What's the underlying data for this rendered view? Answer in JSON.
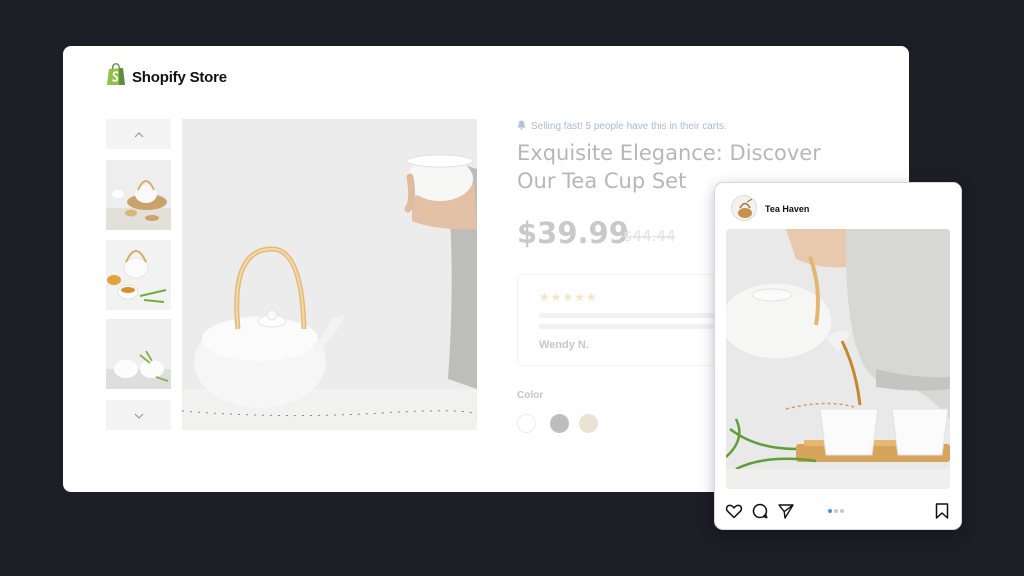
{
  "store": {
    "brand_name": "Shopify Store",
    "logo_icon": "shopping-bag-icon",
    "brand_color": "#95bf47"
  },
  "gallery": {
    "up_icon": "chevron-up-icon",
    "down_icon": "chevron-down-icon"
  },
  "product": {
    "urgency_text": "Selling fast! 5 people have this in their carts.",
    "urgency_icon": "bell-icon",
    "title": "Exquisite Elegance: Discover Our Tea Cup Set",
    "price": "$39.99",
    "compare_price": "$44.44",
    "review": {
      "stars": "★★★★★",
      "rating": 5,
      "reviewer": "Wendy N."
    },
    "color_label": "Color",
    "colors": [
      "#ffffff",
      "#b5b5b5",
      "#e8dcc9"
    ]
  },
  "post": {
    "account_name": "Tea Haven",
    "action_icons": [
      "heart-icon",
      "comment-icon",
      "send-icon",
      "bookmark-icon"
    ],
    "carousel_active_color": "#3897f0"
  }
}
